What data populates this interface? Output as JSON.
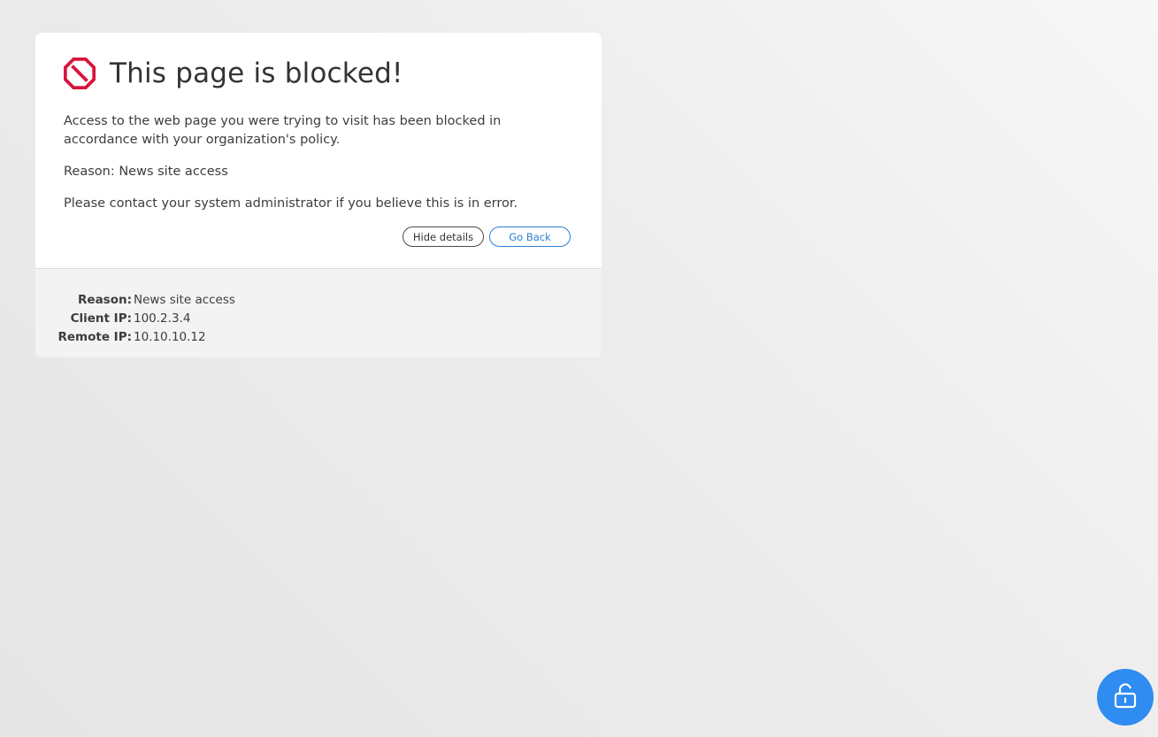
{
  "page": {
    "title": "This page is blocked!",
    "message": "Access to the web page you were trying to visit has been blocked in accordance with your organization's policy.",
    "reason_line": "Reason: News site access",
    "contact": "Please contact your system administrator if you believe this is in error."
  },
  "actions": {
    "hide_details": "Hide details",
    "go_back": "Go Back"
  },
  "details": {
    "rows": [
      {
        "label": "Reason:",
        "value": "News site access"
      },
      {
        "label": "Client IP:",
        "value": "100.2.3.4"
      },
      {
        "label": "Remote IP:",
        "value": "10.10.10.12"
      }
    ]
  },
  "icons": {
    "block": "block-icon",
    "unlock": "unlock-icon"
  },
  "colors": {
    "block_icon": "#d8153c",
    "accent": "#2b7fd4",
    "fab": "#2f8cf0"
  }
}
